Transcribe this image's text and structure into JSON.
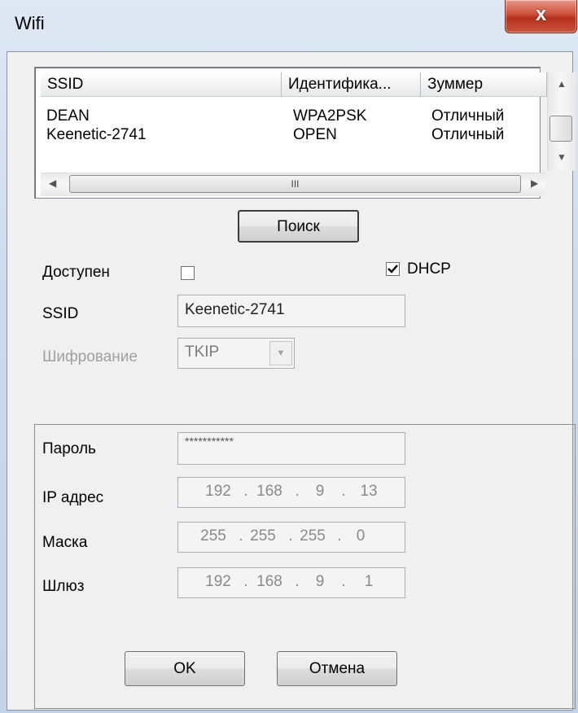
{
  "window": {
    "title": "Wifi",
    "close_glyph": "x"
  },
  "list": {
    "columns": [
      "SSID",
      "Идентифика...",
      "Зуммер"
    ],
    "rows": [
      [
        "DEAN",
        "WPA2PSK",
        "Отличный"
      ],
      [
        "Keenetic-2741",
        "OPEN",
        "Отличный"
      ]
    ],
    "hscroll_grip": "III"
  },
  "search_label": "Поиск",
  "available": {
    "label": "Доступен",
    "checked": false
  },
  "dhcp": {
    "label": "DHCP",
    "checked": true
  },
  "ssid": {
    "label": "SSID",
    "value": "Keenetic-2741"
  },
  "encryption": {
    "label": "Шифрование",
    "value": "TKIP"
  },
  "password": {
    "label": "Пароль",
    "value": "***********"
  },
  "ip": {
    "label": "IP адрес",
    "octets": [
      "192",
      "168",
      "9",
      "13"
    ]
  },
  "mask": {
    "label": "Маска",
    "octets": [
      "255",
      "255",
      "255",
      "0"
    ]
  },
  "gateway": {
    "label": "Шлюз",
    "octets": [
      "192",
      "168",
      "9",
      "1"
    ]
  },
  "buttons": {
    "ok": "OK",
    "cancel": "Отмена"
  }
}
